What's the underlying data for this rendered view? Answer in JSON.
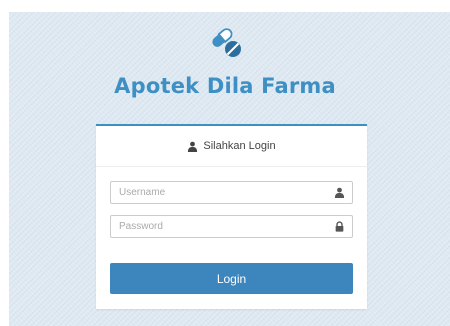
{
  "app": {
    "title": "Apotek Dila Farma",
    "logo_icon": "pills-icon",
    "accent_color": "#3d8fc4"
  },
  "login_panel": {
    "heading": "Silahkan Login",
    "heading_icon": "user-icon",
    "username": {
      "placeholder": "Username",
      "value": "",
      "icon": "user-icon"
    },
    "password": {
      "placeholder": "Password",
      "value": "",
      "icon": "lock-icon"
    },
    "submit_label": "Login",
    "button_color": "#3d85bd"
  }
}
